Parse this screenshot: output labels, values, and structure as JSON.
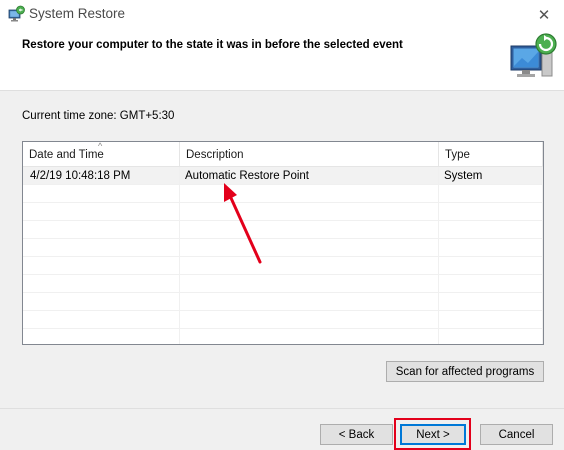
{
  "window": {
    "title": "System Restore"
  },
  "header": {
    "heading": "Restore your computer to the state it was in before the selected event"
  },
  "timezone": {
    "label": "Current time zone: GMT+5:30"
  },
  "table": {
    "columns": [
      "Date and Time",
      "Description",
      "Type"
    ],
    "sort_column": "Date and Time",
    "rows": [
      {
        "date_time": "4/2/19 10:48:18 PM",
        "description": "Automatic Restore Point",
        "type": "System",
        "selected": true
      }
    ],
    "empty_row_count": 9
  },
  "buttons": {
    "scan": "Scan for affected programs",
    "back": "< Back",
    "next": "Next >",
    "cancel": "Cancel"
  },
  "icons": {
    "close": "close-icon",
    "title": "system-restore-icon",
    "header": "system-restore-computer-icon"
  },
  "colors": {
    "annotation": "#e3001b",
    "default_button_border": "#0078d7"
  }
}
